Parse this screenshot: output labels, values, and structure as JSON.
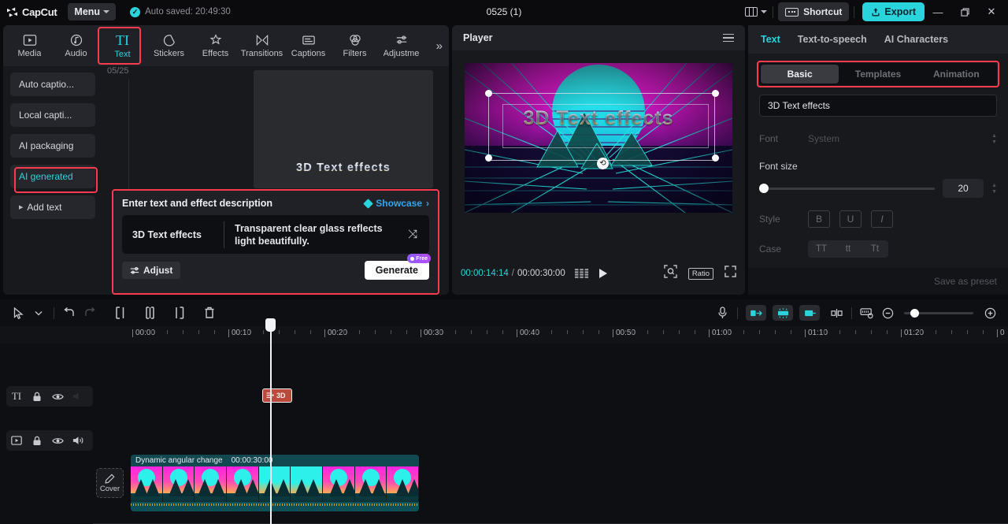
{
  "titlebar": {
    "logo_text": "CapCut",
    "menu_label": "Menu",
    "autosave_text": "Auto saved: 20:49:30",
    "project_title": "0525 (1)",
    "shortcut_label": "Shortcut",
    "export_label": "Export",
    "minimize": "—",
    "maximize": "❐",
    "close": "✕"
  },
  "left_panel": {
    "tabs": [
      {
        "label": "Media",
        "icon": "media-icon",
        "active": false
      },
      {
        "label": "Audio",
        "icon": "audio-icon",
        "active": false
      },
      {
        "label": "Text",
        "icon": "text-icon",
        "active": true
      },
      {
        "label": "Stickers",
        "icon": "stickers-icon",
        "active": false
      },
      {
        "label": "Effects",
        "icon": "effects-icon",
        "active": false
      },
      {
        "label": "Transitions",
        "icon": "transitions-icon",
        "active": false
      },
      {
        "label": "Captions",
        "icon": "captions-icon",
        "active": false
      },
      {
        "label": "Filters",
        "icon": "filters-icon",
        "active": false
      },
      {
        "label": "Adjustme",
        "icon": "adjustment-icon",
        "active": false
      }
    ],
    "more_label": "»",
    "side_items": [
      {
        "label": "Auto captio...",
        "selected": false
      },
      {
        "label": "Local capti...",
        "selected": false
      },
      {
        "label": "AI packaging",
        "selected": false
      },
      {
        "label": "AI generated",
        "selected": true
      },
      {
        "label": "Add text",
        "selected": false,
        "expandable": true
      }
    ],
    "date_label": "05/25",
    "preview_card_text": "3D  Text  effects"
  },
  "prompt_panel": {
    "title": "Enter text and effect description",
    "showcase_label": "Showcase",
    "showcase_chevron": "›",
    "text_value": "3D Text effects",
    "effect_description": "Transparent clear glass reflects light beautifully.",
    "shuffle_icon": "⤨",
    "adjust_label": "Adjust",
    "generate_label": "Generate",
    "free_badge": "Free"
  },
  "player": {
    "title": "Player",
    "stage_text": "3D Text effects",
    "current_time": "00:00:14:14",
    "time_separator": "/",
    "total_time": "00:00:30:00",
    "ratio_label": "Ratio"
  },
  "right_panel": {
    "tabs": [
      {
        "label": "Text",
        "active": true
      },
      {
        "label": "Text-to-speech",
        "active": false
      },
      {
        "label": "AI Characters",
        "active": false
      }
    ],
    "segments": [
      {
        "label": "Basic",
        "active": true
      },
      {
        "label": "Templates",
        "active": false
      },
      {
        "label": "Animation",
        "active": false
      }
    ],
    "text_value": "3D Text effects",
    "font_label": "Font",
    "font_value": "System",
    "font_size_label": "Font size",
    "font_size_value": "20",
    "style_label": "Style",
    "style_buttons": [
      "B",
      "U",
      "I"
    ],
    "case_label": "Case",
    "case_buttons": [
      "TT",
      "tt",
      "Tt"
    ],
    "save_preset_label": "Save as preset"
  },
  "timeline": {
    "ruler_marks": [
      "00:00",
      "00:10",
      "00:20",
      "00:30",
      "00:40",
      "00:50",
      "01:00",
      "01:10",
      "01:20",
      "0"
    ],
    "cover_label": "Cover",
    "text_clip_label": "3D",
    "video_clip_name": "Dynamic angular change",
    "video_clip_duration": "00:00:30:00"
  },
  "colors": {
    "accent": "#2ad4dd",
    "highlight_box": "#fb3b4d",
    "link_blue": "#2fa8f2",
    "text_clip": "#bb4a3c"
  }
}
